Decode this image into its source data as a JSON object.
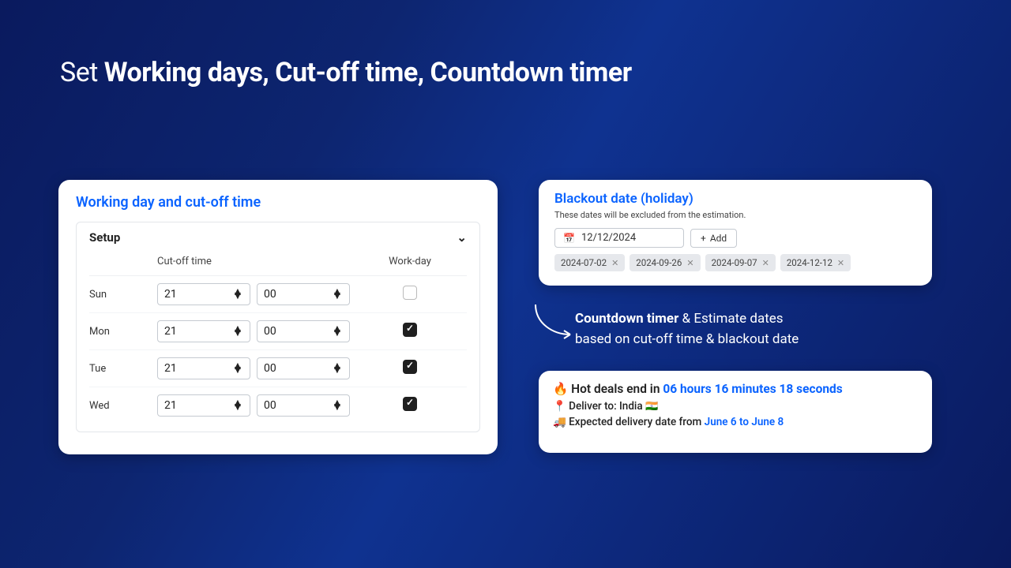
{
  "page_title_prefix": "Set ",
  "page_title_bold": "Working days, Cut-off time, Countdown timer",
  "working": {
    "title": "Working day and cut-off time",
    "setup_label": "Setup",
    "col_cutoff": "Cut-off time",
    "col_workday": "Work-day",
    "rows": [
      {
        "day": "Sun",
        "hh": "21",
        "mm": "00",
        "checked": false
      },
      {
        "day": "Mon",
        "hh": "21",
        "mm": "00",
        "checked": true
      },
      {
        "day": "Tue",
        "hh": "21",
        "mm": "00",
        "checked": true
      },
      {
        "day": "Wed",
        "hh": "21",
        "mm": "00",
        "checked": true
      }
    ]
  },
  "blackout": {
    "title": "Blackout date (holiday)",
    "subtitle": "These dates will be excluded from the estimation.",
    "input_value": "12/12/2024",
    "add_label": "Add",
    "chips": [
      "2024-07-02",
      "2024-09-26",
      "2024-09-07",
      "2024-12-12"
    ]
  },
  "annotation": {
    "bold": "Countdown timer",
    "rest1": " & Estimate dates",
    "line2": "based on cut-off time & blackout date"
  },
  "deals": {
    "fire": "🔥",
    "hot_prefix": " Hot deals end in ",
    "hot_time": "06 hours 16 minutes 18 seconds",
    "pin": "📍",
    "deliver_label": " Deliver to: India ",
    "flag": "🇮🇳",
    "truck": "🚚",
    "expected_prefix": " Expected delivery date from ",
    "expected_range": "June 6 to June 8"
  }
}
